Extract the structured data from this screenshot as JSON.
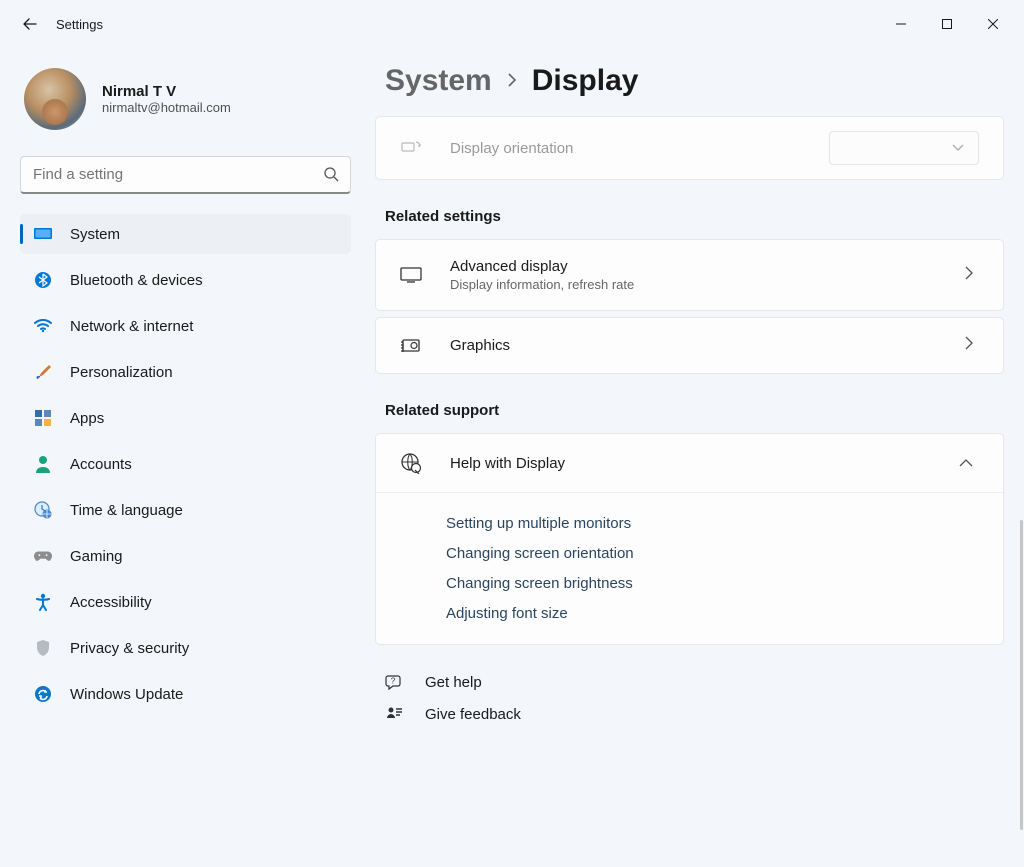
{
  "app_title": "Settings",
  "window_controls": {
    "min": "minimize",
    "max": "maximize",
    "close": "close"
  },
  "user": {
    "name": "Nirmal T V",
    "email": "nirmaltv@hotmail.com"
  },
  "search": {
    "placeholder": "Find a setting"
  },
  "nav": {
    "items": [
      {
        "label": "System",
        "icon": "system-icon",
        "color": "#0078d4"
      },
      {
        "label": "Bluetooth & devices",
        "icon": "bluetooth-icon",
        "color": "#0078d4"
      },
      {
        "label": "Network & internet",
        "icon": "wifi-icon",
        "color": "#0078d4"
      },
      {
        "label": "Personalization",
        "icon": "brush-icon",
        "color": "#c66a2d"
      },
      {
        "label": "Apps",
        "icon": "apps-icon",
        "color": "#2f6db0"
      },
      {
        "label": "Accounts",
        "icon": "person-icon",
        "color": "#1aa37a"
      },
      {
        "label": "Time & language",
        "icon": "clock-globe-icon",
        "color": "#4a88c7"
      },
      {
        "label": "Gaming",
        "icon": "gamepad-icon",
        "color": "#8d8d8d"
      },
      {
        "label": "Accessibility",
        "icon": "accessibility-icon",
        "color": "#0078d4"
      },
      {
        "label": "Privacy & security",
        "icon": "shield-icon",
        "color": "#9aa0a6"
      },
      {
        "label": "Windows Update",
        "icon": "update-icon",
        "color": "#0c78c9"
      }
    ],
    "active_index": 0
  },
  "breadcrumb": {
    "parent": "System",
    "current": "Display"
  },
  "orientation_row": {
    "title": "Display orientation"
  },
  "related_settings": {
    "heading": "Related settings",
    "items": [
      {
        "title": "Advanced display",
        "sub": "Display information, refresh rate",
        "icon": "monitor-icon"
      },
      {
        "title": "Graphics",
        "sub": "",
        "icon": "gpu-icon"
      }
    ]
  },
  "related_support": {
    "heading": "Related support",
    "header": "Help with Display",
    "links": [
      "Setting up multiple monitors",
      "Changing screen orientation",
      "Changing screen brightness",
      "Adjusting font size"
    ]
  },
  "footer": {
    "help": "Get help",
    "feedback": "Give feedback"
  }
}
